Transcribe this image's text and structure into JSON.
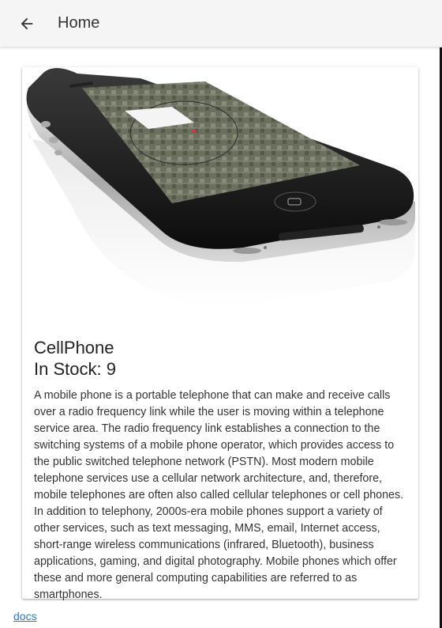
{
  "appbar": {
    "back_icon": "arrow-left-icon",
    "title": "Home"
  },
  "product": {
    "image_desc": "phone-image",
    "name": "CellPhone",
    "stock": "In Stock: 9",
    "description": "A mobile phone is a portable telephone that can make and receive calls over a radio frequency link while the user is moving within a telephone service area. The radio frequency link establishes a connection to the switching systems of a mobile phone operator, which provides access to the public switched telephone network (PSTN). Most modern mobile telephone services use a cellular network architecture, and, therefore, mobile telephones are often also called cellular telephones or cell phones. In addition to telephony, 2000s-era mobile phones support a variety of other services, such as text messaging, MMS, email, Internet access, short-range wireless communications (infrared, Bluetooth), business applications, gaming, and digital photography. Mobile phones which offer these and more general computing capabilities are referred to as smartphones."
  },
  "footer": {
    "docs_link": "docs"
  },
  "colors": {
    "appbar_bg": "#f5f5f5",
    "link": "#2979c9",
    "text": "#333333"
  }
}
